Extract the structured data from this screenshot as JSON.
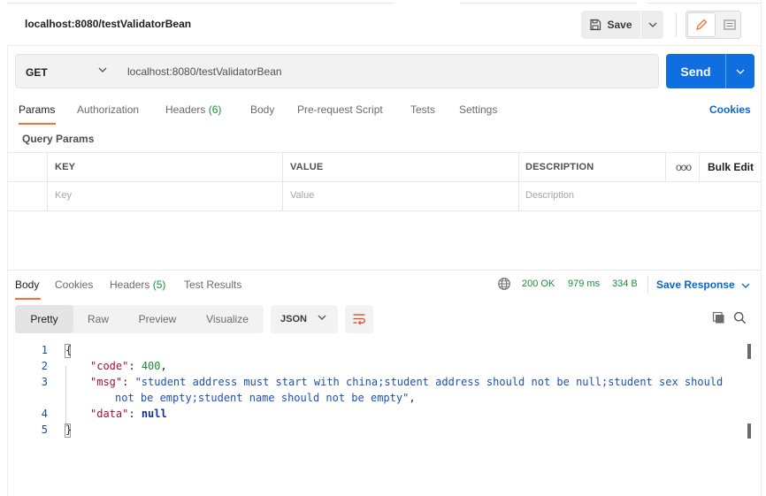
{
  "colors": {
    "accent_orange": "#ff6c37",
    "send_blue": "#0f6fe0",
    "link_blue": "#0b66d0",
    "success_green": "#1a8f3a"
  },
  "request": {
    "title": "localhost:8080/testValidatorBean",
    "save_label": "Save",
    "method": "GET",
    "url": "localhost:8080/testValidatorBean",
    "send_label": "Send",
    "tabs": [
      {
        "label": "Params",
        "count": ""
      },
      {
        "label": "Authorization",
        "count": ""
      },
      {
        "label": "Headers",
        "count": "(6)"
      },
      {
        "label": "Body",
        "count": ""
      },
      {
        "label": "Pre-request Script",
        "count": ""
      },
      {
        "label": "Tests",
        "count": ""
      },
      {
        "label": "Settings",
        "count": ""
      }
    ],
    "cookies_label": "Cookies",
    "query_params_label": "Query Params",
    "table": {
      "headers": [
        "KEY",
        "VALUE",
        "DESCRIPTION"
      ],
      "bulk_edit": "Bulk Edit",
      "more": "ooo",
      "placeholders": [
        "Key",
        "Value",
        "Description"
      ]
    }
  },
  "response": {
    "tabs": [
      {
        "label": "Body",
        "count": ""
      },
      {
        "label": "Cookies",
        "count": ""
      },
      {
        "label": "Headers",
        "count": "(5)"
      },
      {
        "label": "Test Results",
        "count": ""
      }
    ],
    "status": "200 OK",
    "time": "979 ms",
    "size": "334 B",
    "save_response": "Save Response",
    "views": [
      "Pretty",
      "Raw",
      "Preview",
      "Visualize"
    ],
    "format": "JSON",
    "line_numbers": [
      "1",
      "2",
      "3",
      "4",
      "5"
    ],
    "code": {
      "open_brace": "{",
      "close_brace": "}",
      "key_code": "\"code\"",
      "val_code": "400",
      "key_msg": "\"msg\"",
      "val_msg_1": "\"student address must start with china;student address should not be null;student sex should",
      "val_msg_2": "not be empty;student name should not be empty\"",
      "key_data": "\"data\"",
      "val_data": "null"
    }
  },
  "icons": [
    "save-icon",
    "chevron-down-icon",
    "edit-icon",
    "document-icon",
    "globe-icon",
    "wrap-lines-icon",
    "copy-icon",
    "search-icon"
  ]
}
